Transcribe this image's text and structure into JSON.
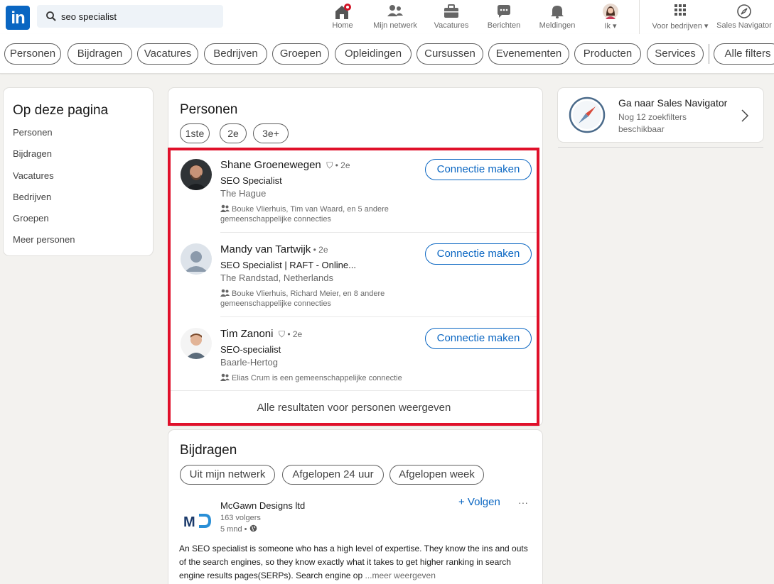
{
  "search": {
    "value": "seo specialist"
  },
  "nav": {
    "home": "Home",
    "network": "Mijn netwerk",
    "jobs": "Vacatures",
    "messages": "Berichten",
    "notifications": "Meldingen",
    "me": "Ik",
    "business": "Voor bedrijven",
    "sales": "Sales Navigator"
  },
  "filters": [
    "Personen",
    "Bijdragen",
    "Vacatures",
    "Bedrijven",
    "Groepen",
    "Opleidingen",
    "Cursussen",
    "Evenementen",
    "Producten",
    "Services",
    "Alle filters"
  ],
  "left": {
    "title": "Op deze pagina",
    "links": [
      "Personen",
      "Bijdragen",
      "Vacatures",
      "Bedrijven",
      "Groepen",
      "Meer personen"
    ]
  },
  "people": {
    "title": "Personen",
    "chips": [
      "1ste",
      "2e",
      "3e+"
    ],
    "items": [
      {
        "name": "Shane Groenewegen",
        "degree": " • 2e",
        "title": "SEO Specialist",
        "location": "The Hague",
        "connections": "Bouke Vlierhuis, Tim van Waard, en 5 andere gemeenschappelijke connecties",
        "button": "Connectie maken"
      },
      {
        "name": "Mandy van Tartwijk",
        "degree": " • 2e",
        "title": "SEO Specialist | RAFT - Online...",
        "location": "The Randstad, Netherlands",
        "connections": "Bouke Vlierhuis, Richard Meier, en 8 andere gemeenschappelijke connecties",
        "button": "Connectie maken"
      },
      {
        "name": "Tim Zanoni",
        "degree": " • 2e",
        "title": "SEO-specialist",
        "location": "Baarle-Hertog",
        "connections": "Elias Crum is een gemeenschappelijke connectie",
        "button": "Connectie maken"
      }
    ],
    "all_results": "Alle resultaten voor personen weergeven"
  },
  "posts": {
    "title": "Bijdragen",
    "chips": [
      "Uit mijn netwerk",
      "Afgelopen 24 uur",
      "Afgelopen week"
    ],
    "item": {
      "author": "McGawn Designs ltd",
      "followers": "163 volgers",
      "time": "5 mnd •",
      "follow": "+ Volgen",
      "more": "···",
      "text": "An SEO specialist is someone who has a high level of expertise. They know the ins and outs of the search engines, so they know exactly what it takes to get higher ranking in search engine results pages(SERPs). Search engine op",
      "see_more": "...meer weergeven"
    }
  },
  "sales_card": {
    "title": "Ga naar Sales Navigator",
    "subtitle": "Nog 12 zoekfilters beschikbaar"
  },
  "colors": {
    "accent": "#0a66c2",
    "highlight": "#e0102a",
    "background": "#f3f2ef"
  },
  "icons": [
    "search-icon",
    "home-icon",
    "network-icon",
    "briefcase-icon",
    "message-icon",
    "bell-icon",
    "grid-icon",
    "compass-icon",
    "chevron-right-icon",
    "connections-icon",
    "globe-icon"
  ]
}
